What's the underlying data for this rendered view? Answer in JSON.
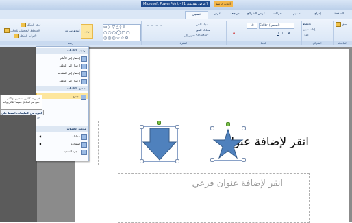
{
  "window": {
    "title": "Microsoft PowerPoint - [عرض تقديمي 1]",
    "badge": "أدوات الرسم"
  },
  "tabs": [
    "الصفحة الرئيسية",
    "إدراج",
    "تصميم",
    "حركات",
    "عرض الشرائح",
    "مراجعة",
    "عرض",
    "تنسيق"
  ],
  "ribbon": {
    "groups": {
      "clipboard": "الحافظة",
      "slides": "الشرائح",
      "font": "الخط",
      "paragraph": "الفقرة",
      "drawing": "رسم"
    },
    "font_name": "Calibri (أساسي)",
    "font_size": "18",
    "text_direction": "اتجاه النص",
    "align_text": "محاذاة النص",
    "smartart": "تحويل إلى SmartArt",
    "arrange": "ترتيب",
    "quick_styles": "أنماط سريعة",
    "shape_fill": "تعبئة الشكل",
    "shape_outline": "المخطط التفصيلي للشكل",
    "shape_effects": "تأثيرات الشكل",
    "new_slide": "شريحة جديدة",
    "layout": "تخطيط",
    "reset": "إعادة تعيين",
    "delete": "حذف",
    "paste": "لصق",
    "bold": "B",
    "italic": "I",
    "underline": "U"
  },
  "menu": {
    "order_header": "ترتيب الكائنات",
    "bring_front": "إحضار إلى الأمام",
    "send_back": "إرسال إلى الخلف",
    "bring_forward": "إحضار إلى المقدمة",
    "send_backward": "إرسال إلى الخلف",
    "group_header": "تجميع الكائنات",
    "group": "تجميع",
    "ungroup": "إلغاء التجميع",
    "regroup": "إعادة التجميع",
    "position_header": "موضع الكائنات",
    "align": "محاذاة",
    "rotate": "استدارة",
    "selection_pane": "جزء التحديد..."
  },
  "tooltip": {
    "body": "قم بربط كائنين محددين أو أكثر حتى يتم التعامل معهما ككائن واحد.",
    "help": "لمزيد من التعليمات، اضغط على F1."
  },
  "slide": {
    "title_placeholder": "انقر لإضافة عنوان",
    "subtitle_placeholder": "انقر لإضافة عنوان فرعي"
  },
  "colors": {
    "ribbon_bg": "#d6e4f5",
    "highlight": "#fde69d",
    "shape_fill": "#4f81bd",
    "slide_bg": "#ffffff"
  }
}
